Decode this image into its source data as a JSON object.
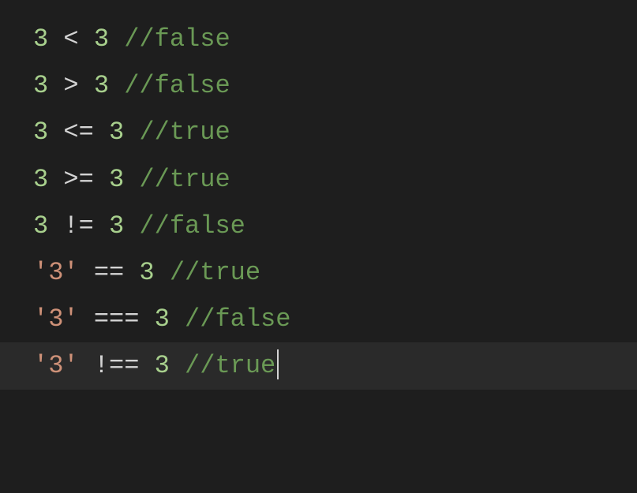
{
  "lines": [
    {
      "active": false,
      "tokens": [
        {
          "type": "number",
          "text": "3"
        },
        {
          "type": "operator",
          "text": " < "
        },
        {
          "type": "number",
          "text": "3"
        },
        {
          "type": "operator",
          "text": " "
        },
        {
          "type": "comment",
          "text": "//false"
        }
      ]
    },
    {
      "active": false,
      "tokens": [
        {
          "type": "number",
          "text": "3"
        },
        {
          "type": "operator",
          "text": " > "
        },
        {
          "type": "number",
          "text": "3"
        },
        {
          "type": "operator",
          "text": " "
        },
        {
          "type": "comment",
          "text": "//false"
        }
      ]
    },
    {
      "active": false,
      "tokens": [
        {
          "type": "number",
          "text": "3"
        },
        {
          "type": "operator",
          "text": " <= "
        },
        {
          "type": "number",
          "text": "3"
        },
        {
          "type": "operator",
          "text": " "
        },
        {
          "type": "comment",
          "text": "//true"
        }
      ]
    },
    {
      "active": false,
      "tokens": [
        {
          "type": "number",
          "text": "3"
        },
        {
          "type": "operator",
          "text": " >= "
        },
        {
          "type": "number",
          "text": "3"
        },
        {
          "type": "operator",
          "text": " "
        },
        {
          "type": "comment",
          "text": "//true"
        }
      ]
    },
    {
      "active": false,
      "tokens": [
        {
          "type": "number",
          "text": "3"
        },
        {
          "type": "operator",
          "text": " != "
        },
        {
          "type": "number",
          "text": "3"
        },
        {
          "type": "operator",
          "text": " "
        },
        {
          "type": "comment",
          "text": "//false"
        }
      ]
    },
    {
      "active": false,
      "tokens": [
        {
          "type": "string",
          "text": "'3'"
        },
        {
          "type": "operator",
          "text": " == "
        },
        {
          "type": "number",
          "text": "3"
        },
        {
          "type": "operator",
          "text": " "
        },
        {
          "type": "comment",
          "text": "//true"
        }
      ]
    },
    {
      "active": false,
      "tokens": [
        {
          "type": "string",
          "text": "'3'"
        },
        {
          "type": "operator",
          "text": " === "
        },
        {
          "type": "number",
          "text": "3"
        },
        {
          "type": "operator",
          "text": " "
        },
        {
          "type": "comment",
          "text": "//false"
        }
      ]
    },
    {
      "active": true,
      "tokens": [
        {
          "type": "string",
          "text": "'3'"
        },
        {
          "type": "operator",
          "text": " !== "
        },
        {
          "type": "number",
          "text": "3"
        },
        {
          "type": "operator",
          "text": " "
        },
        {
          "type": "comment",
          "text": "//true"
        }
      ],
      "cursor": true
    }
  ]
}
